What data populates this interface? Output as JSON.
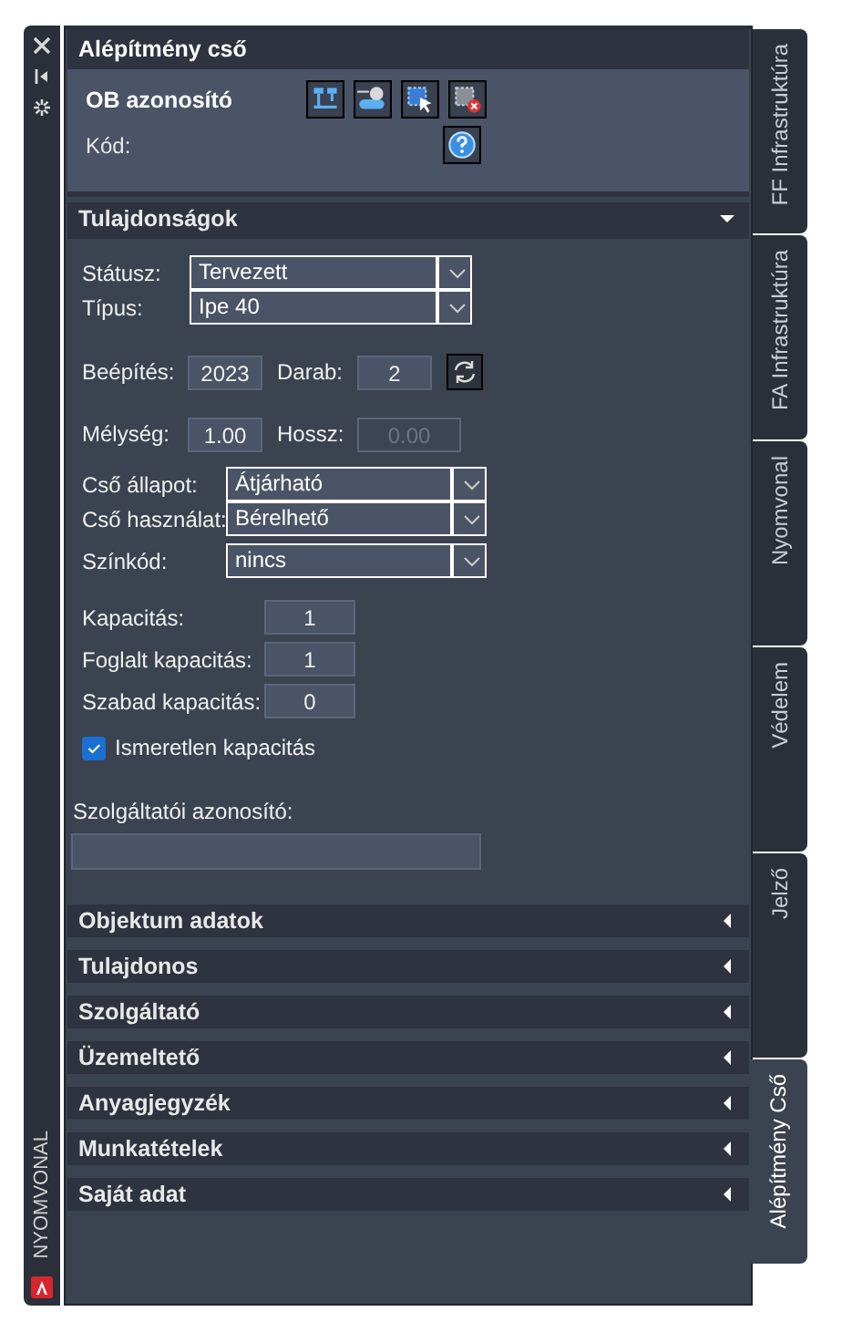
{
  "left_strip": {
    "label": "NYOMVONAL"
  },
  "title": "Alépítmény cső",
  "ob": {
    "label": "OB azonosító",
    "code_label": "Kód:"
  },
  "sections": [
    {
      "title": "Tulajdonságok",
      "expanded": true
    },
    {
      "title": "Objektum adatok",
      "expanded": false
    },
    {
      "title": "Tulajdonos",
      "expanded": false
    },
    {
      "title": "Szolgáltató",
      "expanded": false
    },
    {
      "title": "Üzemeltető",
      "expanded": false
    },
    {
      "title": "Anyagjegyzék",
      "expanded": false
    },
    {
      "title": "Munkatételek",
      "expanded": false
    },
    {
      "title": "Saját adat",
      "expanded": false
    }
  ],
  "properties": {
    "type_selects": [
      {
        "label": "Státusz:",
        "value": "Tervezett"
      },
      {
        "label": "Típus:",
        "value": "Ipe 40"
      }
    ],
    "measures": [
      {
        "items": [
          {
            "label": "Beépítés:",
            "value": "2023",
            "disabled": false
          },
          {
            "label": "Darab:",
            "value": "2",
            "disabled": false
          }
        ],
        "refresh": true
      },
      {
        "items": [
          {
            "label": "Mélység:",
            "value": "1.00",
            "disabled": false
          },
          {
            "label": "Hossz:",
            "value": "0.00",
            "disabled": true
          }
        ]
      }
    ],
    "pipe_selects": [
      {
        "label": "Cső állapot:",
        "value": "Átjárható"
      },
      {
        "label": "Cső használat:",
        "value": "Bérelhető"
      },
      {
        "label": "Színkód:",
        "value": "nincs"
      }
    ],
    "capacities": [
      {
        "label": "Kapacitás:",
        "value": "1"
      },
      {
        "label": "Foglalt kapacitás:",
        "value": "1"
      },
      {
        "label": "Szabad kapacitás:",
        "value": "0"
      }
    ],
    "unknown_capacity": {
      "label": "Ismeretlen kapacitás",
      "checked": true
    },
    "provider_id": {
      "label": "Szolgáltatói azonosító:"
    }
  },
  "side_tabs": [
    {
      "label": "FF Infrastruktúra",
      "selected": false
    },
    {
      "label": "FA Infrastruktúra",
      "selected": false
    },
    {
      "label": "Nyomvonal",
      "selected": false
    },
    {
      "label": "Védelem",
      "selected": false
    },
    {
      "label": "Jelző",
      "selected": false
    },
    {
      "label": "Alépítmény Cső",
      "selected": true
    }
  ]
}
